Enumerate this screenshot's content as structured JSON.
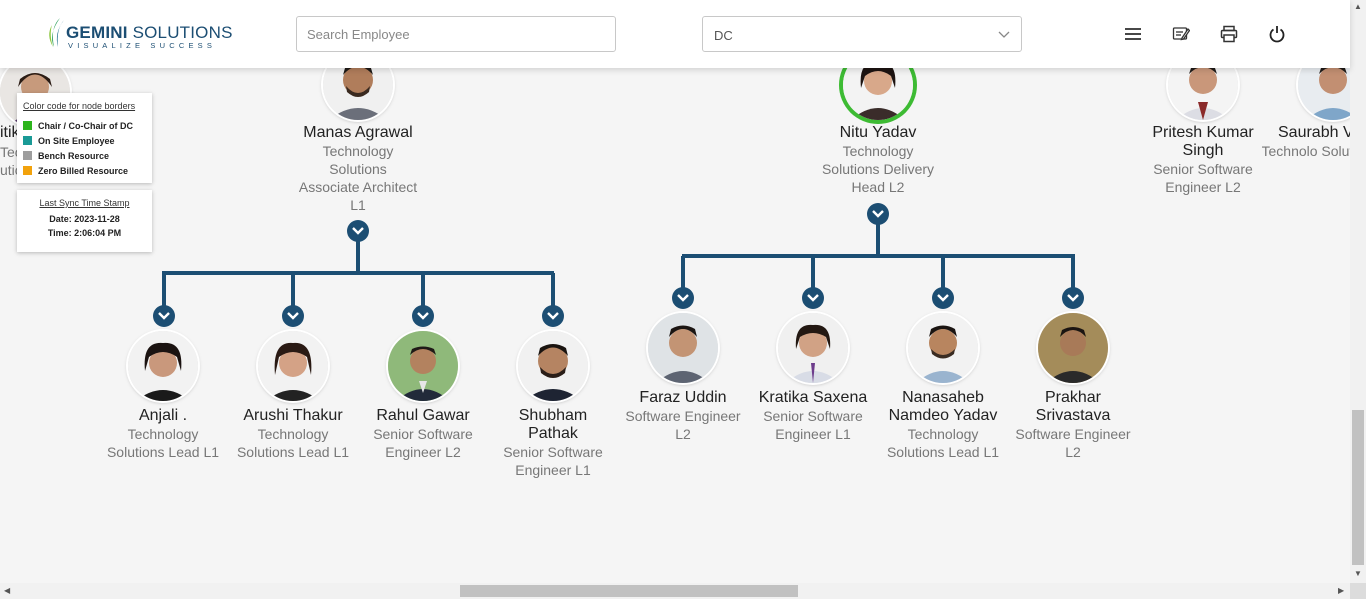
{
  "header": {
    "logo": {
      "name_bold": "GEMINI",
      "name_rest": " SOLUTIONS",
      "tagline": "VISUALIZE SUCCESS"
    },
    "search": {
      "placeholder": "Search Employee",
      "value": ""
    },
    "dc_select": {
      "value": "DC"
    },
    "icons": [
      "menu-icon",
      "feedback-icon",
      "print-icon",
      "power-icon"
    ]
  },
  "legend": {
    "title": "Color code for node borders",
    "items": [
      {
        "label": "Chair / Co-Chair of DC",
        "color": "#2db51d"
      },
      {
        "label": "On Site Employee",
        "color": "#1a9a96"
      },
      {
        "label": "Bench Resource",
        "color": "#9e9e9e"
      },
      {
        "label": "Zero Billed Resource",
        "color": "#f2a20c"
      }
    ]
  },
  "sync": {
    "title": "Last Sync Time Stamp",
    "date": "Date: 2023-11-28",
    "time": "Time: 2:06:04 PM"
  },
  "partial_left": {
    "name": "itik",
    "line1": "Tec",
    "line2": "utic"
  },
  "top_nodes": [
    {
      "name": "Manas Agrawal",
      "title": "Technology Solutions Associate Architect L1",
      "border": "none"
    },
    {
      "name": "Nitu Yadav",
      "title": "Technology Solutions Delivery Head L2",
      "border": "chair"
    },
    {
      "name": "Pritesh Kumar Singh",
      "title": "Senior Software Engineer L2",
      "border": "none"
    },
    {
      "name": "Saurabh V",
      "title": "Technolo Solutions Le",
      "border": "none"
    }
  ],
  "manas_children": [
    {
      "name": "Anjali .",
      "title": "Technology Solutions Lead L1"
    },
    {
      "name": "Arushi Thakur",
      "title": "Technology Solutions Lead L1"
    },
    {
      "name": "Rahul Gawar",
      "title": "Senior Software Engineer L2"
    },
    {
      "name": "Shubham Pathak",
      "title": "Senior Software Engineer L1"
    }
  ],
  "nitu_children": [
    {
      "name": "Faraz Uddin",
      "title": "Software Engineer L2"
    },
    {
      "name": "Kratika Saxena",
      "title": "Senior Software Engineer L1"
    },
    {
      "name": "Nanasaheb Namdeo Yadav",
      "title": "Technology Solutions Lead L1"
    },
    {
      "name": "Prakhar Srivastava",
      "title": "Software Engineer L2"
    }
  ],
  "colors": {
    "brand": "#1c4e73",
    "chair_border": "#3dbb33"
  }
}
